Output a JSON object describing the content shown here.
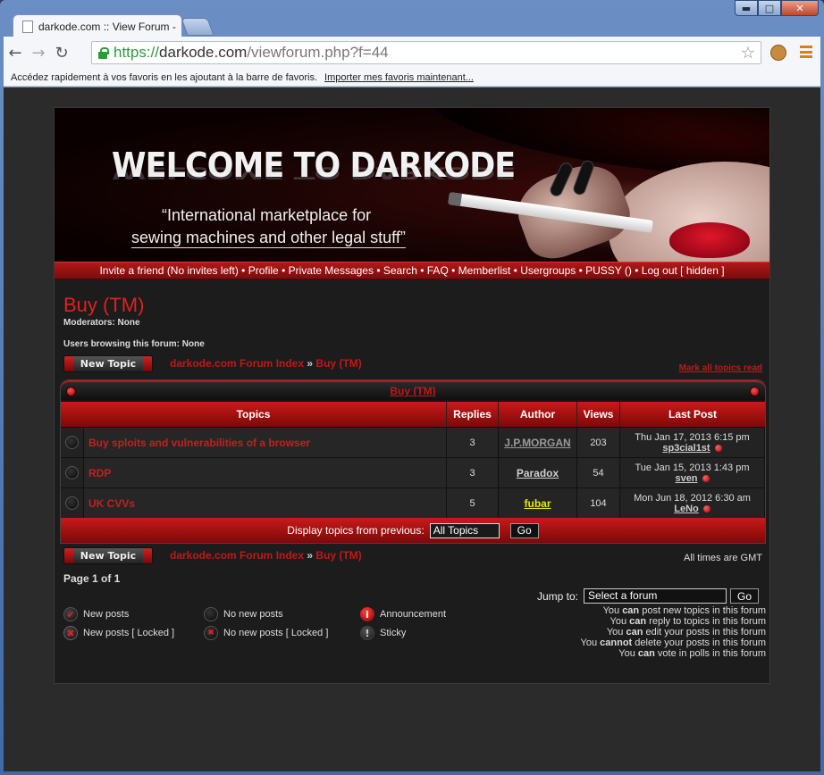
{
  "browser": {
    "tab_title": "darkode.com :: View Forum -",
    "url_scheme": "https://",
    "url_domain": "darkode.com",
    "url_path": "/viewforum.php?f=44",
    "bookmarks_text": "Accédez rapidement à vos favoris en les ajoutant à la barre de favoris.",
    "bookmarks_link": "Importer mes favoris maintenant..."
  },
  "banner": {
    "title": "WELCOME TO DARKODE",
    "tagline_1": "“International marketplace for",
    "tagline_2": "sewing machines and other legal stuff”"
  },
  "navbar": [
    "Invite a friend (No invites left)",
    "Profile",
    "Private Messages",
    "Search",
    "FAQ",
    "Memberlist",
    "Usergroups",
    "PUSSY ()",
    "Log out [ hidden ]"
  ],
  "forum": {
    "title": "Buy (TM)",
    "moderators": "Moderators: None",
    "browsing": "Users browsing this forum: None",
    "new_topic_label": "New Topic",
    "crumb_index": "darkode.com Forum Index",
    "crumb_sep": "»",
    "crumb_forum": "Buy (TM)",
    "mark_all": "Mark all topics read",
    "table_title": "Buy (TM)"
  },
  "table": {
    "headers": [
      "Topics",
      "Replies",
      "Author",
      "Views",
      "Last Post"
    ],
    "rows": [
      {
        "topic": "Buy sploits and vulnerabilities of a browser",
        "replies": "3",
        "author": "J.P.MORGAN",
        "author_color": "#9a9a9a",
        "views": "203",
        "last_date": "Thu Jan 17, 2013 6:15 pm",
        "last_user": "sp3cial1st"
      },
      {
        "topic": "RDP",
        "replies": "3",
        "author": "Paradox",
        "author_color": "#cfcfcf",
        "views": "54",
        "last_date": "Tue Jan 15, 2013 1:43 pm",
        "last_user": "sven"
      },
      {
        "topic": "UK CVVs",
        "replies": "5",
        "author": "fubar",
        "author_color": "#e8e800",
        "views": "104",
        "last_date": "Mon Jun 18, 2012 6:30 am",
        "last_user": "LeNo"
      }
    ],
    "filter_label": "Display topics from previous:",
    "filter_value": "All Topics",
    "filter_go": "Go"
  },
  "footer": {
    "times": "All times are GMT",
    "page_info": "Page 1 of 1",
    "jump_label": "Jump to:",
    "jump_value": "Select a forum",
    "jump_go": "Go",
    "permissions": [
      {
        "pre": "You ",
        "key": "can",
        "post": " post new topics in this forum"
      },
      {
        "pre": "You ",
        "key": "can",
        "post": " reply to topics in this forum"
      },
      {
        "pre": "You ",
        "key": "can",
        "post": " edit your posts in this forum"
      },
      {
        "pre": "You ",
        "key": "cannot",
        "post": " delete your posts in this forum"
      },
      {
        "pre": "You ",
        "key": "can",
        "post": " vote in polls in this forum"
      }
    ],
    "legend": {
      "new_posts": "New posts",
      "no_new_posts": "No new posts",
      "announcement": "Announcement",
      "new_posts_locked": "New posts [ Locked ]",
      "no_new_posts_locked": "No new posts [ Locked ]",
      "sticky": "Sticky"
    }
  }
}
